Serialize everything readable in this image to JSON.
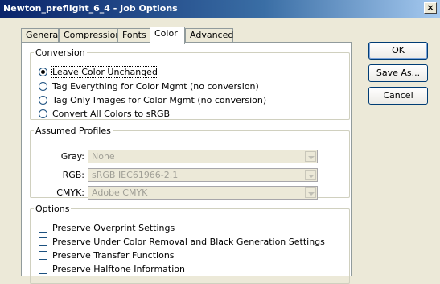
{
  "window": {
    "title": "Newton_preflight_6_4 - Job Options",
    "close_label": "×"
  },
  "tabs": [
    {
      "label": "General"
    },
    {
      "label": "Compression"
    },
    {
      "label": "Fonts"
    },
    {
      "label": "Color",
      "active": true
    },
    {
      "label": "Advanced"
    }
  ],
  "conversion": {
    "legend": "Conversion",
    "options": [
      {
        "label": "Leave Color Unchanged",
        "checked": true
      },
      {
        "label": "Tag Everything for Color Mgmt (no conversion)",
        "checked": false
      },
      {
        "label": "Tag Only Images for Color Mgmt (no conversion)",
        "checked": false
      },
      {
        "label": "Convert All Colors to sRGB",
        "checked": false
      }
    ]
  },
  "profiles": {
    "legend": "Assumed Profiles",
    "gray": {
      "label": "Gray:",
      "value": "None"
    },
    "rgb": {
      "label": "RGB:",
      "value": "sRGB IEC61966-2.1"
    },
    "cmyk": {
      "label": "CMYK:",
      "value": "Adobe CMYK"
    },
    "disabled": true
  },
  "options": {
    "legend": "Options",
    "items": [
      {
        "label": "Preserve Overprint Settings",
        "checked": false
      },
      {
        "label": "Preserve Under Color Removal and Black Generation Settings",
        "checked": false
      },
      {
        "label": "Preserve Transfer Functions",
        "checked": false
      },
      {
        "label": "Preserve Halftone Information",
        "checked": false
      }
    ]
  },
  "buttons": {
    "ok": "OK",
    "save_as": "Save As...",
    "cancel": "Cancel"
  },
  "colors": {
    "title_start": "#0a246a",
    "title_end": "#a6caf0",
    "face": "#ece9d8",
    "disabled_text": "#a09f96"
  }
}
